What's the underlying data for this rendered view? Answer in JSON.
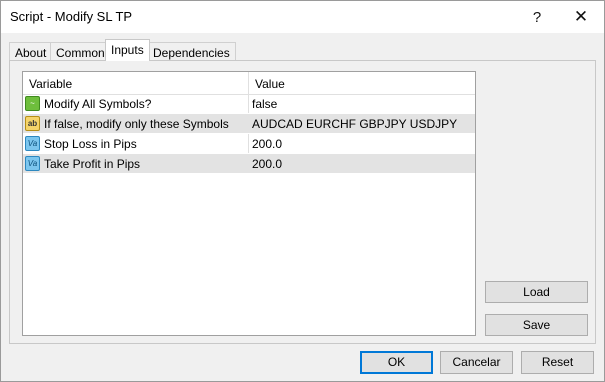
{
  "window": {
    "title": "Script - Modify SL TP",
    "help_glyph": "?",
    "close_glyph": "✕"
  },
  "tabs": [
    {
      "label": "About"
    },
    {
      "label": "Common"
    },
    {
      "label": "Inputs"
    },
    {
      "label": "Dependencies"
    }
  ],
  "active_tab": "Inputs",
  "grid": {
    "columns": {
      "variable": "Variable",
      "value": "Value"
    },
    "rows": [
      {
        "icon": "bool-icon",
        "icon_text": "~",
        "variable": "Modify All Symbols?",
        "value": "false"
      },
      {
        "icon": "string-icon",
        "icon_text": "ab",
        "variable": "If false, modify only these Symbols",
        "value": "AUDCAD EURCHF GBPJPY USDJPY"
      },
      {
        "icon": "double-icon",
        "icon_text": "Va",
        "variable": "Stop Loss in Pips",
        "value": "200.0"
      },
      {
        "icon": "double-icon",
        "icon_text": "Va",
        "variable": "Take Profit in Pips",
        "value": "200.0"
      }
    ]
  },
  "side_buttons": {
    "load": "Load",
    "save": "Save"
  },
  "footer_buttons": {
    "ok": "OK",
    "cancel": "Cancelar",
    "reset": "Reset"
  }
}
